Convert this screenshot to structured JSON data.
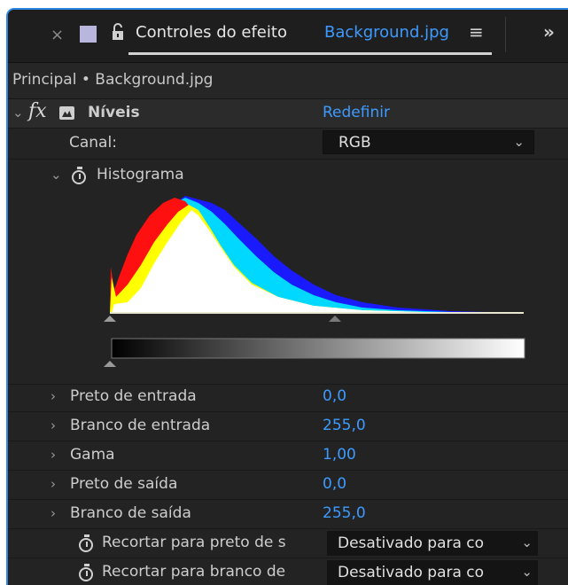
{
  "tabbar": {
    "close_glyph": "×",
    "title": "Controles do efeito",
    "layer_name": "Background.jpg",
    "menu_glyph": "≡",
    "overflow_glyph": "»",
    "label_color": "#b8b6dc"
  },
  "breadcrumb": {
    "text": "Principal • Background.jpg"
  },
  "effect": {
    "fx_label": "fx",
    "name": "Níveis",
    "reset_label": "Redefinir"
  },
  "channel": {
    "label": "Canal:",
    "value": "RGB"
  },
  "histogram": {
    "label": "Histograma"
  },
  "properties": [
    {
      "label": "Preto de entrada",
      "value": "0,0"
    },
    {
      "label": "Branco de entrada",
      "value": "255,0"
    },
    {
      "label": "Gama",
      "value": "1,00"
    },
    {
      "label": "Preto de saída",
      "value": "0,0"
    },
    {
      "label": "Branco de saída",
      "value": "255,0"
    }
  ],
  "clip": [
    {
      "label": "Recortar para preto de s",
      "value": "Desativado para co"
    },
    {
      "label": "Recortar para branco de",
      "value": "Desativado para co"
    }
  ],
  "colors": {
    "accent": "#3d9bff",
    "panel_bg": "#232323",
    "focus_border": "#2e86de"
  }
}
